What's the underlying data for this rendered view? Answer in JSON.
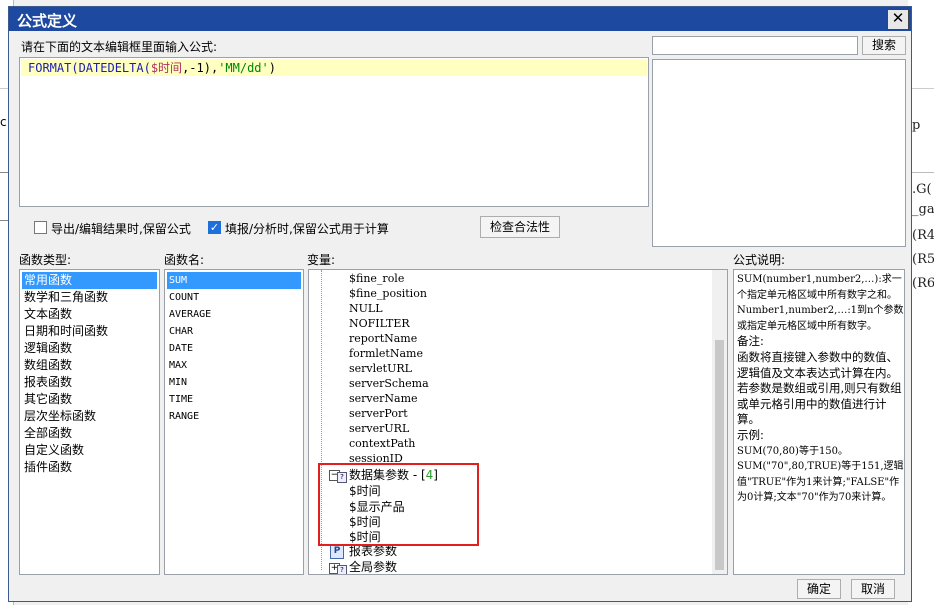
{
  "dialog": {
    "title": "公式定义",
    "close_glyph": "✕",
    "editor_prompt": "请在下面的文本编辑框里面输入公式:",
    "formula": {
      "fn1": "FORMAT(",
      "fn2": "DATEDELTA(",
      "var": "$时间",
      "args": ",-1),",
      "str": "'MM/dd'",
      "end": ")"
    },
    "search_value": "",
    "search_button": "搜索",
    "option_export": "导出/编辑结果时,保留公式",
    "option_export_checked": false,
    "option_fill": "填报/分析时,保留公式用于计算",
    "option_fill_checked": true,
    "check_button": "检查合法性",
    "ok_button": "确定",
    "cancel_button": "取消"
  },
  "func_types": {
    "header": "函数类型:",
    "items": [
      "常用函数",
      "数学和三角函数",
      "文本函数",
      "日期和时间函数",
      "逻辑函数",
      "数组函数",
      "报表函数",
      "其它函数",
      "层次坐标函数",
      "全部函数",
      "自定义函数",
      "插件函数"
    ],
    "selected": 0
  },
  "func_names": {
    "header": "函数名:",
    "items": [
      "SUM",
      "COUNT",
      "AVERAGE",
      "CHAR",
      "DATE",
      "MAX",
      "MIN",
      "TIME",
      "RANGE"
    ],
    "selected": 0
  },
  "variables": {
    "header": "变量:",
    "items": [
      "$fine_role",
      "$fine_position",
      "NULL",
      "NOFILTER",
      "reportName",
      "formletName",
      "servletURL",
      "serverSchema",
      "serverName",
      "serverPort",
      "serverURL",
      "contextPath",
      "sessionID"
    ],
    "dataset_label": "数据集参数 - [",
    "dataset_count": "4",
    "dataset_close": "]",
    "dataset_items": [
      "$时间",
      "$显示产品",
      "$时间",
      "$时间"
    ],
    "report_params": "报表参数",
    "global_params": "全局参数",
    "highlight_color": "#e0201c"
  },
  "description": {
    "header": "公式说明:",
    "lines": [
      "SUM(number1,number2,…):求一个指定单元格区域中所有数字之和。",
      "Number1,number2,…:1到n个参数或指定单元格区域中所有数字。",
      "备注:",
      "函数将直接键入参数中的数值、逻辑值及文本表达式计算在内。若参数是数组或引用,则只有数组或单元格引用中的数值进行计算。",
      "示例:",
      "SUM(70,80)等于150。",
      "SUM(\"70\",80,TRUE)等于151,逻辑值\"TRUE\"作为1来计算;\"FALSE\"作为0计算;文本\"70\"作为70来计算。"
    ]
  },
  "background": {
    "right_texts": [
      "p",
      ".G(",
      "_ga",
      "(R4",
      "(R5",
      "(R6"
    ],
    "left_texts": [
      "c"
    ]
  }
}
